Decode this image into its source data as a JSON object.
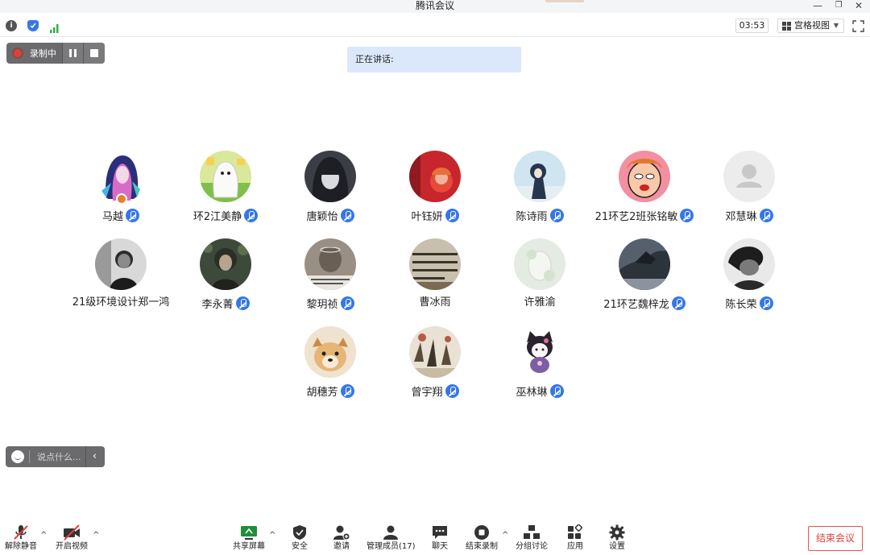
{
  "window": {
    "title": "腾讯会议",
    "minimize": "—",
    "restore": "❐",
    "close": "✕"
  },
  "statusbar": {
    "timer": "03:53",
    "view_label": "宫格视图",
    "view_caret": "▼"
  },
  "recording": {
    "label": "录制中"
  },
  "speaking": {
    "label": "正在讲话:"
  },
  "participants": [
    {
      "name": "马越",
      "mic": true,
      "host": true
    },
    {
      "name": "环2江美静",
      "mic": true
    },
    {
      "name": "唐颖怡",
      "mic": true
    },
    {
      "name": "叶钰妍",
      "mic": true
    },
    {
      "name": "陈诗雨",
      "mic": true
    },
    {
      "name": "21环艺2班张铭敏",
      "mic": true
    },
    {
      "name": "邓慧琳",
      "mic": true
    },
    {
      "name": "21级环境设计郑一鸿",
      "mic": false
    },
    {
      "name": "李永菁",
      "mic": true
    },
    {
      "name": "黎玥祯",
      "mic": true
    },
    {
      "name": "曹冰雨",
      "mic": false
    },
    {
      "name": "许雅渝",
      "mic": false
    },
    {
      "name": "21环艺魏梓龙",
      "mic": true
    },
    {
      "name": "陈长荣",
      "mic": true
    },
    {
      "name": "胡穗芳",
      "mic": true
    },
    {
      "name": "曾宇翔",
      "mic": true
    },
    {
      "name": "巫林琳",
      "mic": true
    }
  ],
  "chat": {
    "placeholder": "说点什么...",
    "collapse": "‹"
  },
  "toolbar": {
    "unmute": "解除静音",
    "video": "开启视频",
    "share": "共享屏幕",
    "security": "安全",
    "invite": "邀请",
    "members": "管理成员(17)",
    "chat": "聊天",
    "end_record": "结束录制",
    "breakout": "分组讨论",
    "apps": "应用",
    "settings": "设置",
    "caret": "^"
  },
  "end_meeting": "结束会议",
  "colors": {
    "accent": "#3577e8",
    "danger": "#e34040",
    "speaking_bg": "#dbe8fb",
    "pill_bg": "#6b6b6e"
  }
}
